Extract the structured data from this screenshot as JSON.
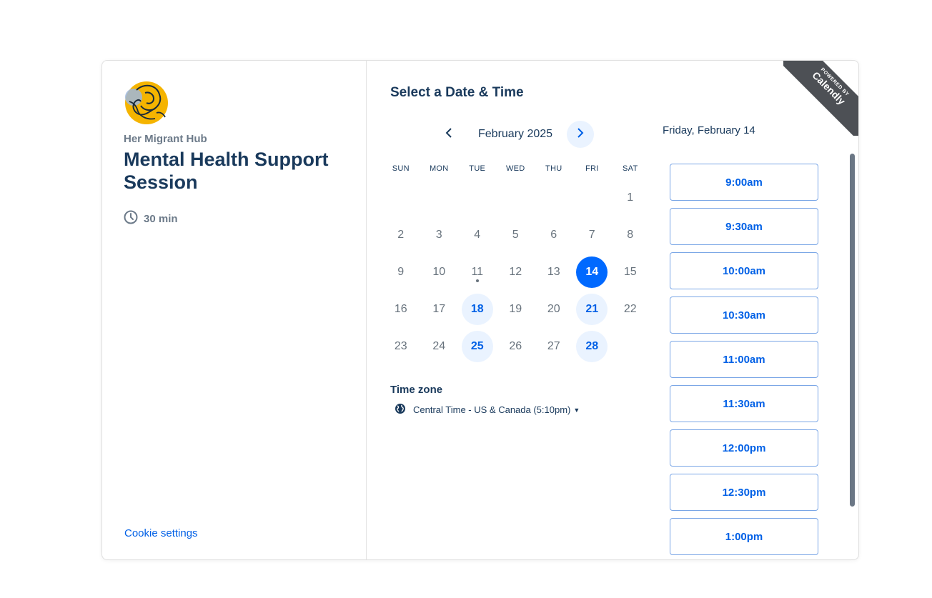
{
  "profile": {
    "org_name": "Her Migrant Hub",
    "event_title": "Mental Health Support Session",
    "duration": "30 min",
    "cookie_settings": "Cookie settings",
    "avatar_icon": "organization-logo"
  },
  "scheduler": {
    "title": "Select a Date & Time",
    "month_label": "February 2025",
    "prev_icon": "chevron-left-icon",
    "next_icon": "chevron-right-icon",
    "weekdays": [
      "SUN",
      "MON",
      "TUE",
      "WED",
      "THU",
      "FRI",
      "SAT"
    ],
    "days": [
      {
        "n": "1",
        "state": "default"
      },
      {
        "n": "2",
        "state": "default"
      },
      {
        "n": "3",
        "state": "default"
      },
      {
        "n": "4",
        "state": "default"
      },
      {
        "n": "5",
        "state": "default"
      },
      {
        "n": "6",
        "state": "default"
      },
      {
        "n": "7",
        "state": "default"
      },
      {
        "n": "8",
        "state": "default"
      },
      {
        "n": "9",
        "state": "default"
      },
      {
        "n": "10",
        "state": "default"
      },
      {
        "n": "11",
        "state": "today"
      },
      {
        "n": "12",
        "state": "default"
      },
      {
        "n": "13",
        "state": "default"
      },
      {
        "n": "14",
        "state": "selected"
      },
      {
        "n": "15",
        "state": "default"
      },
      {
        "n": "16",
        "state": "default"
      },
      {
        "n": "17",
        "state": "default"
      },
      {
        "n": "18",
        "state": "available"
      },
      {
        "n": "19",
        "state": "default"
      },
      {
        "n": "20",
        "state": "default"
      },
      {
        "n": "21",
        "state": "available"
      },
      {
        "n": "22",
        "state": "default"
      },
      {
        "n": "23",
        "state": "default"
      },
      {
        "n": "24",
        "state": "default"
      },
      {
        "n": "25",
        "state": "available"
      },
      {
        "n": "26",
        "state": "default"
      },
      {
        "n": "27",
        "state": "default"
      },
      {
        "n": "28",
        "state": "available"
      }
    ],
    "first_weekday_index": 6,
    "timezone_title": "Time zone",
    "timezone_value": "Central Time - US & Canada (5:10pm)",
    "selected_date": "Friday, February 14",
    "time_slots": [
      "9:00am",
      "9:30am",
      "10:00am",
      "10:30am",
      "11:00am",
      "11:30am",
      "12:00pm",
      "12:30pm",
      "1:00pm"
    ]
  },
  "badge": {
    "small": "POWERED BY",
    "big": "Calendly"
  },
  "colors": {
    "primary": "#0069ff",
    "available_bg": "#eaf3ff",
    "text_dark": "#1a3a5c",
    "text_muted": "#6c7a89",
    "ribbon": "#4d5055"
  }
}
